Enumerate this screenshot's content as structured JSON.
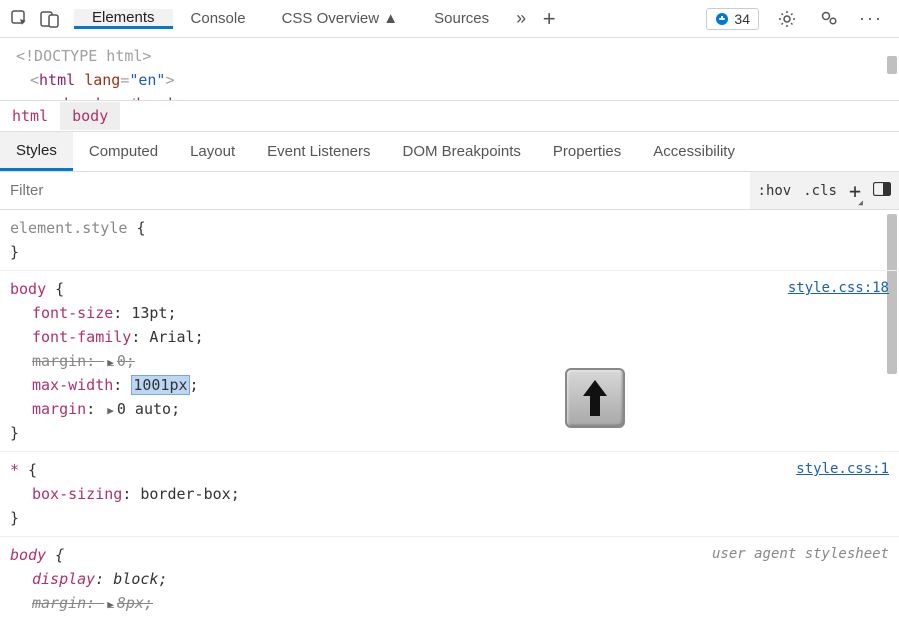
{
  "toolbar": {
    "tabs": [
      "Elements",
      "Console",
      "CSS Overview ▲",
      "Sources"
    ],
    "active_tab": 0,
    "issues_count": "34"
  },
  "dom": {
    "line1_pre": "<!DOCTYPE html>",
    "line2_tag": "html",
    "line2_attr": "lang",
    "line2_val": "\"en\"",
    "line3_open": "head",
    "line3_close": "head"
  },
  "breadcrumb": {
    "items": [
      "html",
      "body"
    ],
    "selected": 1
  },
  "styles_tabs": [
    "Styles",
    "Computed",
    "Layout",
    "Event Listeners",
    "DOM Breakpoints",
    "Properties",
    "Accessibility"
  ],
  "styles_active": 0,
  "filter": {
    "placeholder": "Filter",
    "hov": ":hov",
    "cls": ".cls"
  },
  "rules": {
    "element_style": {
      "selector": "element.style",
      "open": "{",
      "close": "}"
    },
    "body1": {
      "selector": "body",
      "source": "style.css:18",
      "d1p": "font-size",
      "d1v": "13pt",
      "d2p": "font-family",
      "d2v": "Arial",
      "d3p": "margin",
      "d3v": "0",
      "d4p": "max-width",
      "d4v": "1001px",
      "d5p": "margin",
      "d5v": "0 auto"
    },
    "star": {
      "selector": "*",
      "source": "style.css:1",
      "d1p": "box-sizing",
      "d1v": "border-box"
    },
    "body2": {
      "selector": "body",
      "source": "user agent stylesheet",
      "d1p": "display",
      "d1v": "block",
      "d2p": "margin",
      "d2v": "8px"
    }
  }
}
